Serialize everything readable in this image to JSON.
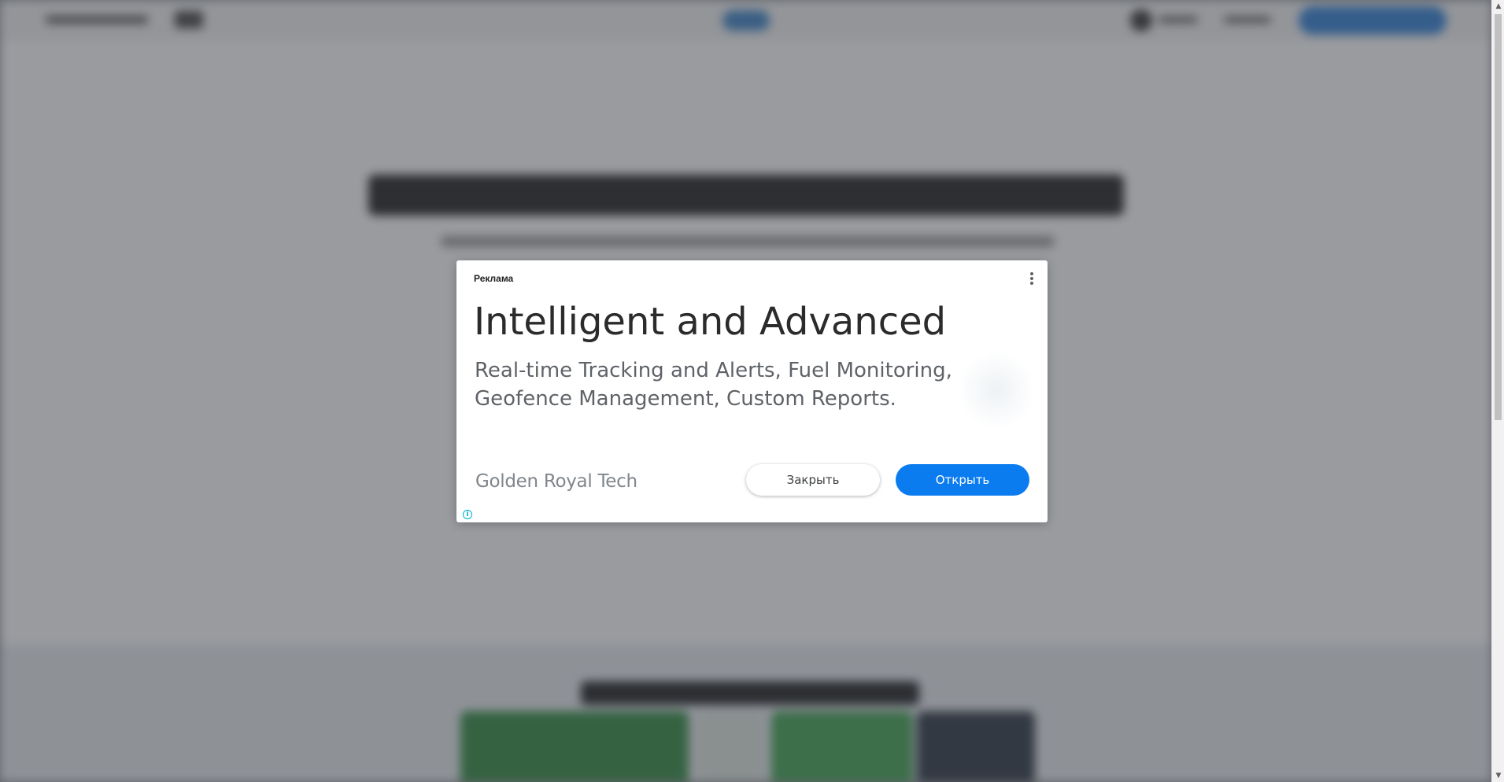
{
  "ad": {
    "label": "Реклама",
    "headline": "Intelligent and Advanced",
    "description": "Real-time Tracking and Alerts, Fuel Monitoring, Geofence Management, Custom Reports.",
    "advertiser": "Golden Royal Tech",
    "close_label": "Закрыть",
    "open_label": "Открыть",
    "info_glyph": "i"
  },
  "colors": {
    "overlay": "#3c4046",
    "open_button": "#0b7cf0",
    "info_icon": "#00aecd"
  },
  "icons": {
    "menu": "more-vert-icon",
    "info": "info-icon"
  }
}
